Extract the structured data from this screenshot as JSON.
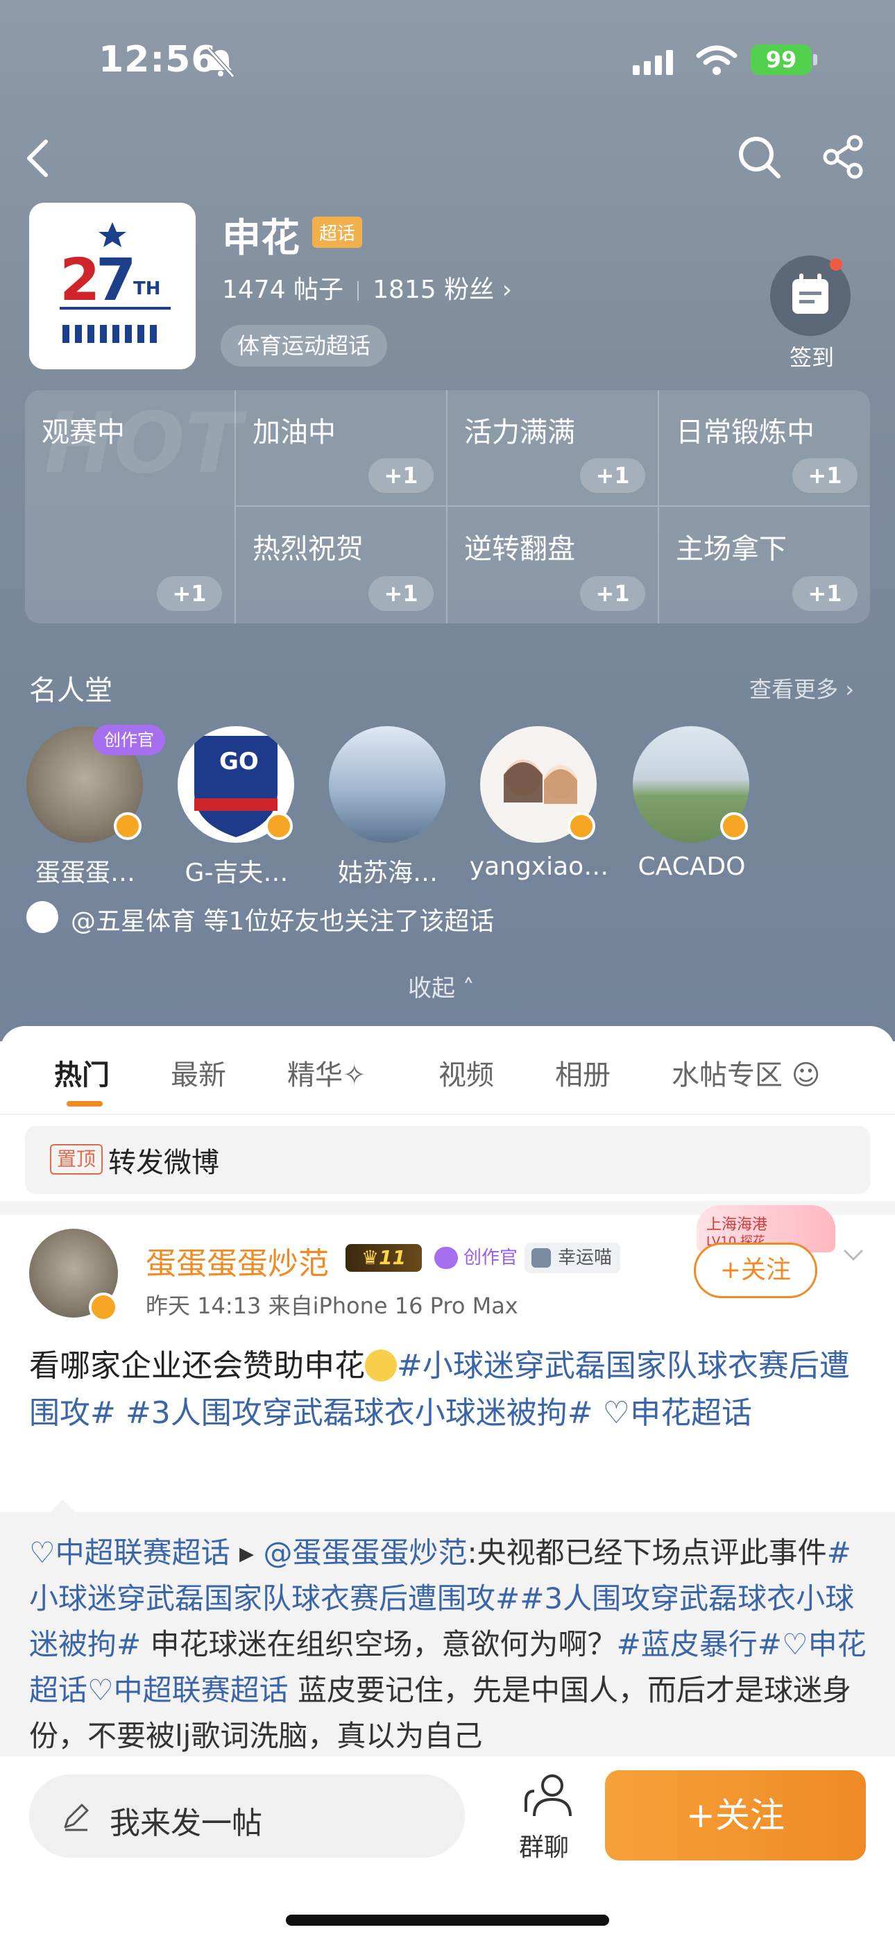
{
  "status_bar": {
    "time": "12:56",
    "battery": "99"
  },
  "topic": {
    "title": "申花",
    "badge": "超话",
    "posts": "1474 帖子",
    "fans": "1815 粉丝",
    "category": "体育运动超话",
    "checkin_label": "签到"
  },
  "reactions": {
    "watermark": "HOT",
    "items": [
      {
        "label": "观赛中",
        "plus": "+1"
      },
      {
        "label": "加油中",
        "plus": "+1"
      },
      {
        "label": "活力满满",
        "plus": "+1"
      },
      {
        "label": "日常锻炼中",
        "plus": "+1"
      },
      {
        "label": "热烈祝贺",
        "plus": "+1"
      },
      {
        "label": "逆转翻盘",
        "plus": "+1"
      },
      {
        "label": "主场拿下",
        "plus": "+1"
      }
    ]
  },
  "hall_of_fame": {
    "title": "名人堂",
    "more": "查看更多",
    "creator_tag": "创作官",
    "members": [
      {
        "name": "蛋蛋蛋…"
      },
      {
        "name": "G-吉夫…"
      },
      {
        "name": "姑苏海…"
      },
      {
        "name": "yangxiao…"
      },
      {
        "name": "CACADO"
      }
    ],
    "friends_text": "@五星体育 等1位好友也关注了该超话",
    "collapse": "收起"
  },
  "tabs": [
    {
      "label": "热门",
      "active": true
    },
    {
      "label": "最新"
    },
    {
      "label": "精华"
    },
    {
      "label": "视频"
    },
    {
      "label": "相册"
    },
    {
      "label": "水帖专区"
    }
  ],
  "pinned": {
    "tag": "置顶",
    "text": "转发微博"
  },
  "post": {
    "author": "蛋蛋蛋蛋炒范",
    "level": "11",
    "creator_badge": "创作官",
    "lucky_badge": "幸运喵",
    "meta": "昨天 14:13  来自iPhone 16 Pro Max",
    "fan_card_line1": "上海海港",
    "fan_card_line2": "LV10 探花",
    "follow_label": "+关注",
    "text_plain": "看哪家企业还会赞助申花",
    "topic1": "#小球迷穿武磊国家队球衣赛后遭围攻#",
    "topic2": "#3人围攻穿武磊球衣小球迷被拘#",
    "topic3": "申花超话",
    "repost": {
      "source_topic": "中超联赛超话",
      "mention": "@蛋蛋蛋蛋炒范",
      "body1": ":央视都已经下场点评此事件",
      "topic_a": "#小球迷穿武磊国家队球衣赛后遭围攻##3人围攻穿武磊球衣小球迷被拘#",
      "body2": " 申花球迷在组织空场，意欲何为啊？",
      "topic_b": "#蓝皮暴行#",
      "topic_c": "申花超话",
      "topic_d": "中超联赛超话",
      "body3": " 蓝皮要记住，先是中国人，而后才是球迷身份，不要被lj歌词洗脑，真以为自己"
    }
  },
  "bottom_bar": {
    "compose_placeholder": "我来发一帖",
    "group_chat": "群聊",
    "follow": "+关注"
  }
}
